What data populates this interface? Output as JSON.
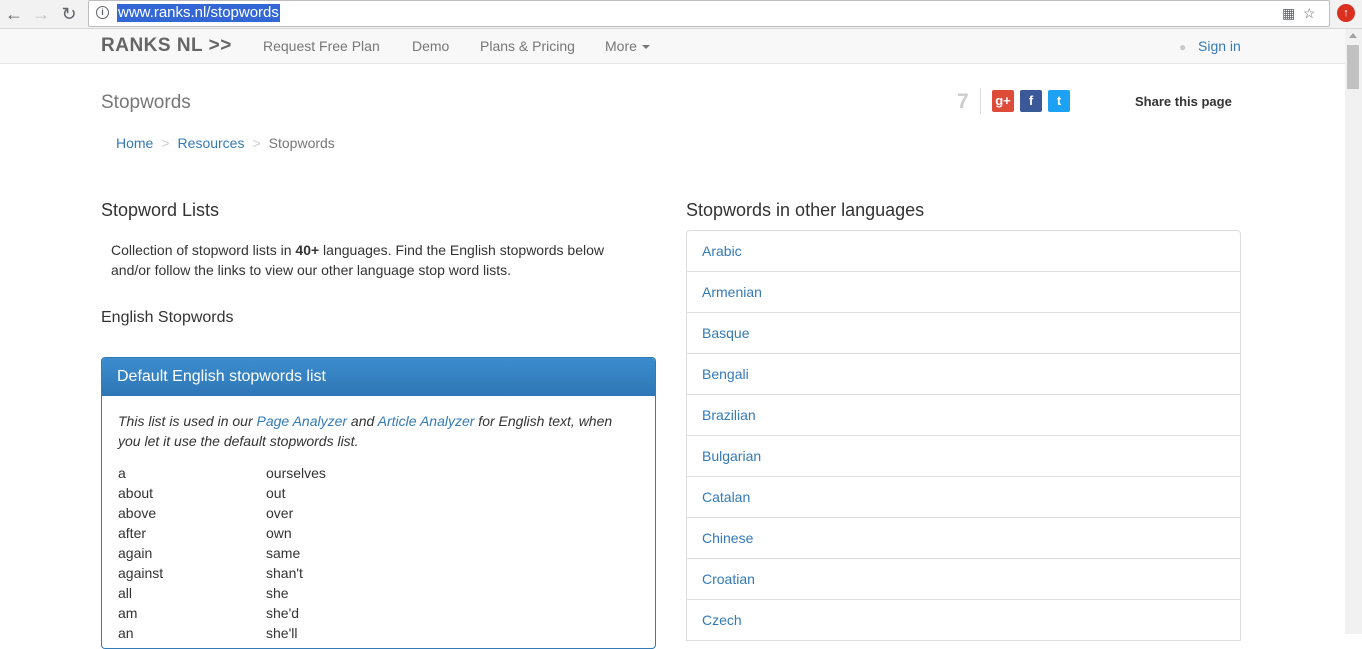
{
  "browser": {
    "url": "www.ranks.nl/stopwords",
    "back_icon": "arrow-left-icon",
    "forward_icon": "arrow-right-icon",
    "reload_icon": "reload-icon"
  },
  "site_nav": {
    "brand": "RANKS NL >>",
    "links": [
      "Request Free Plan",
      "Demo",
      "Plans & Pricing",
      "More"
    ],
    "signin": "Sign in"
  },
  "header": {
    "title": "Stopwords",
    "share_count": "7",
    "share_label": "Share this page"
  },
  "breadcrumb": [
    "Home",
    "Resources",
    "Stopwords"
  ],
  "left": {
    "heading": "Stopword Lists",
    "intro_before": "Collection of stopword lists in ",
    "intro_bold": "40+",
    "intro_after": " languages. Find the English stopwords below and/or follow the links to view our other language stop word lists.",
    "subheading": "English Stopwords",
    "panel": {
      "title": "Default English stopwords list",
      "note_1": "This list is used in our ",
      "note_link1": "Page Analyzer",
      "note_2": " and ",
      "note_link2": "Article Analyzer",
      "note_3": " for English text, when you let it use the default stopwords list.",
      "col1": [
        "a",
        "about",
        "above",
        "after",
        "again",
        "against",
        "all",
        "am",
        "an"
      ],
      "col2": [
        "ourselves",
        "out",
        "over",
        "own",
        "same",
        "shan't",
        "she",
        "she'd",
        "she'll"
      ]
    }
  },
  "right": {
    "heading": "Stopwords in other languages",
    "languages": [
      "Arabic",
      "Armenian",
      "Basque",
      "Bengali",
      "Brazilian",
      "Bulgarian",
      "Catalan",
      "Chinese",
      "Croatian",
      "Czech"
    ]
  },
  "colors": {
    "link": "#337ab7",
    "panel_header": "#337ab7",
    "google_plus": "#dd4b39",
    "facebook": "#3b5998",
    "twitter": "#1da1f2"
  }
}
